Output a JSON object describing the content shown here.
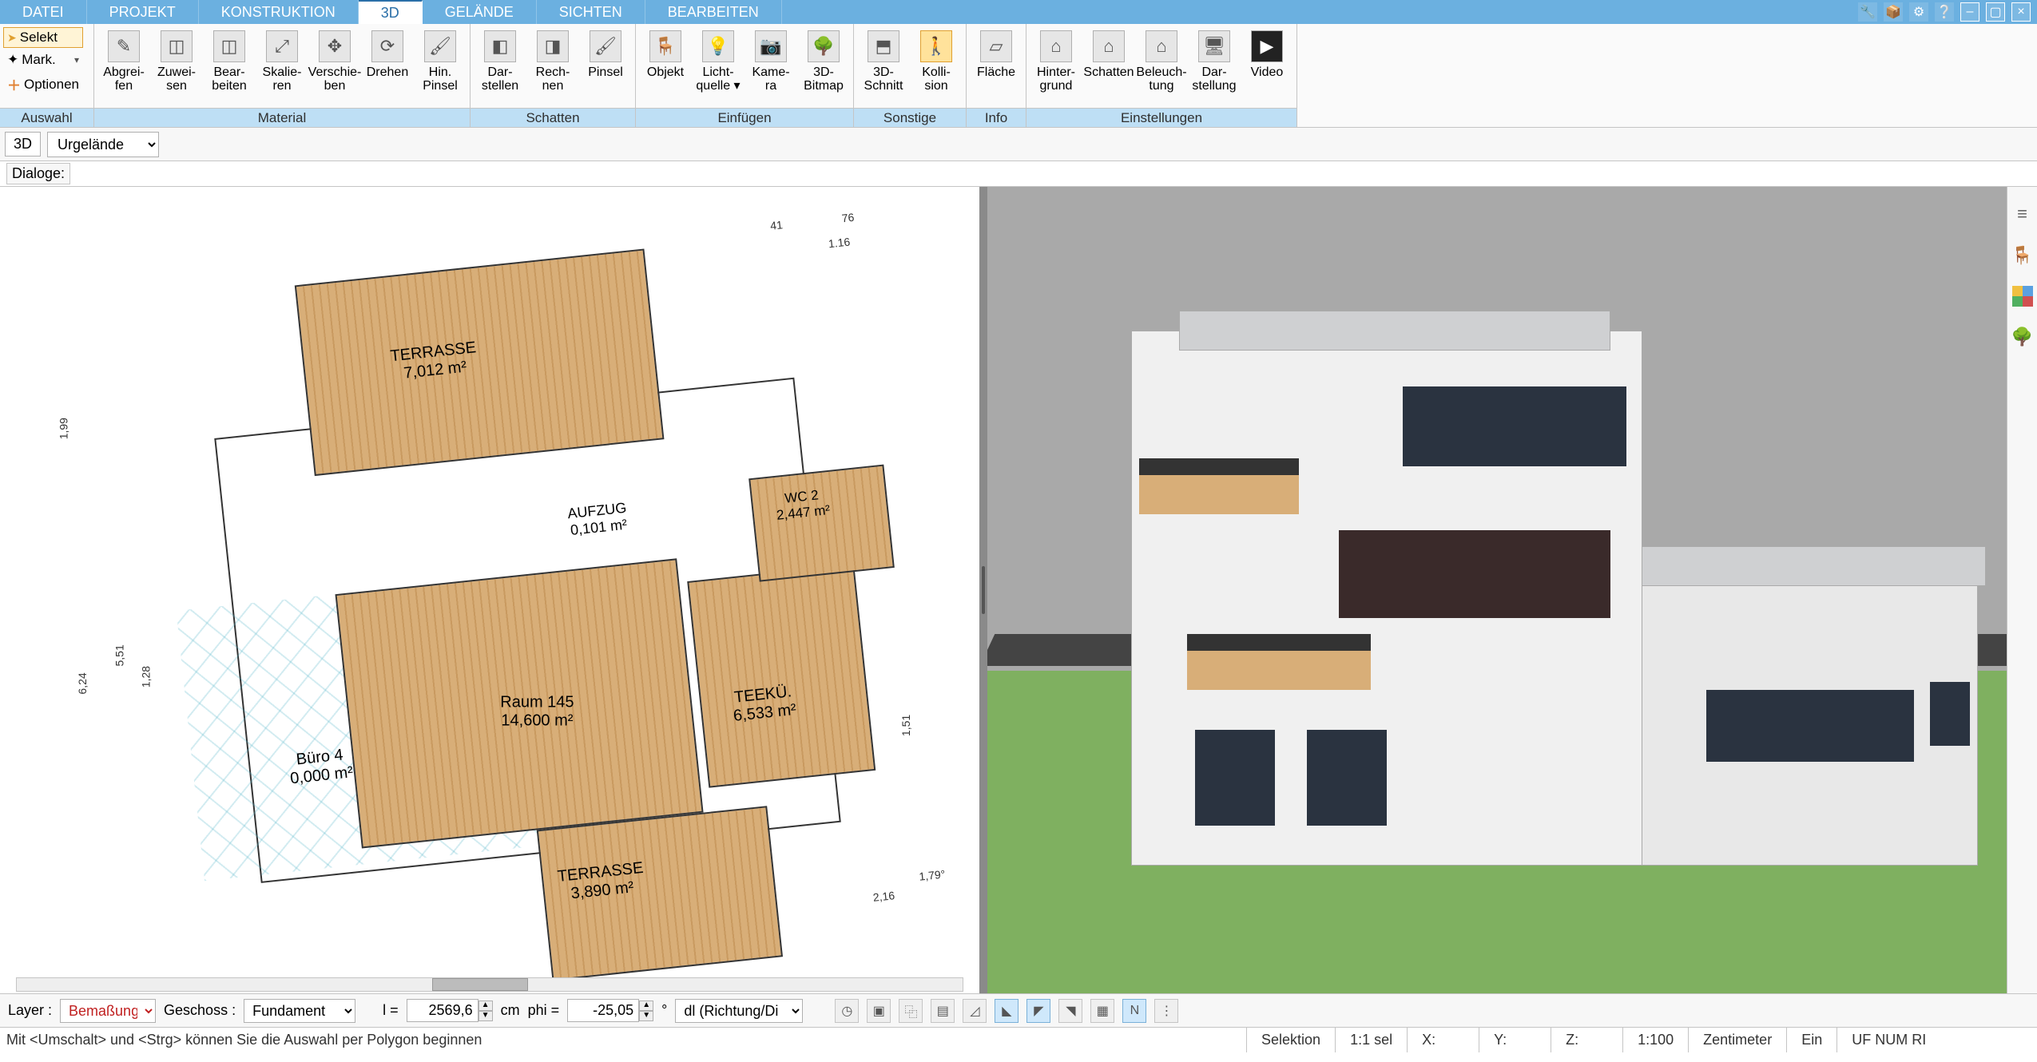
{
  "menu": {
    "tabs": [
      "DATEI",
      "PROJEKT",
      "KONSTRUKTION",
      "3D",
      "GELÄNDE",
      "SICHTEN",
      "BEARBEITEN"
    ],
    "active_index": 3
  },
  "ribbon": {
    "sel": {
      "selekt": "Selekt",
      "mark": "Mark.",
      "opt": "Optionen",
      "caption": "Auswahl"
    },
    "material": {
      "caption": "Material",
      "items": [
        "Abgrei-\nfen",
        "Zuwei-\nsen",
        "Bear-\nbeiten",
        "Skalie-\nren",
        "Verschie-\nben",
        "Drehen",
        "Hin.\nPinsel"
      ]
    },
    "schatten": {
      "caption": "Schatten",
      "items": [
        "Dar-\nstellen",
        "Rech-\nnen",
        "Pinsel"
      ]
    },
    "einfuegen": {
      "caption": "Einfügen",
      "items": [
        "Objekt",
        "Licht-\nquelle ▾",
        "Kame-\nra",
        "3D-\nBitmap"
      ]
    },
    "sonstige": {
      "caption": "Sonstige",
      "items": [
        "3D-\nSchnitt",
        "Kolli-\nsion"
      ],
      "active_index": 1
    },
    "info": {
      "caption": "Info",
      "items": [
        "Fläche"
      ]
    },
    "einstellungen": {
      "caption": "Einstellungen",
      "items": [
        "Hinter-\ngrund",
        "Schatten",
        "Beleuch-\ntung",
        "Dar-\nstellung",
        "Video"
      ]
    }
  },
  "subbar": {
    "pill": "3D",
    "select_value": "Urgelände"
  },
  "dialoge": {
    "label": "Dialoge:"
  },
  "plan": {
    "rooms": {
      "terrasse1": {
        "name": "TERRASSE",
        "area": "7,012 m²"
      },
      "aufzug": {
        "name": "AUFZUG",
        "area": "0,101 m²"
      },
      "wc2": {
        "name": "WC 2",
        "area": "2,447 m²"
      },
      "raum145": {
        "name": "Raum 145",
        "area": "14,600 m²"
      },
      "buero4": {
        "name": "Büro 4",
        "area": "0,000 m²"
      },
      "teekue": {
        "name": "TEEKÜ.",
        "area": "6,533 m²"
      },
      "terrasse2": {
        "name": "TERRASSE",
        "area": "3,890 m²"
      }
    },
    "dims": {
      "d1": "1,99",
      "d2": "6,24",
      "d3": "5,51",
      "d4": "1,28",
      "d5": "1,51",
      "d6": "2,16",
      "d7": "1,79°",
      "d8": "41",
      "d9": "76",
      "d10": "1.16"
    }
  },
  "bottom": {
    "layer_label": "Layer :",
    "layer_value": "Bemaßung",
    "geschoss_label": "Geschoss :",
    "geschoss_value": "Fundament",
    "l_label": "l =",
    "l_value": "2569,6",
    "l_unit": "cm",
    "phi_label": "phi =",
    "phi_value": "-25,05",
    "phi_unit": "°",
    "dl_value": "dl (Richtung/Di"
  },
  "status": {
    "hint": "Mit <Umschalt> und <Strg> können Sie die Auswahl per Polygon beginnen",
    "mode": "Selektion",
    "sel": "1:1 sel",
    "x": "X:",
    "y": "Y:",
    "z": "Z:",
    "scale": "1:100",
    "unit": "Zentimeter",
    "ein": "Ein",
    "caps": "UF NUM RI"
  }
}
